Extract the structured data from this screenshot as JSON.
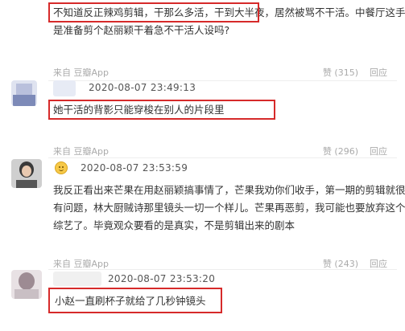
{
  "comments": [
    {
      "lines": [
        "不知道反正辣鸡剪辑，干那么多活，干到大半夜，居然被骂不干活。中餐厅这手",
        "是准备剪个赵丽颖干着急不干活人设吗?"
      ],
      "source": "来自 豆瓣App",
      "like_label": "赞 (315)",
      "reply_label": "回应"
    },
    {
      "time": "2020-08-07 23:49:13",
      "lines": [
        "她干活的背影只能穿梭在别人的片段里"
      ],
      "source": "来自 豆瓣App",
      "like_label": "赞 (296)",
      "reply_label": "回应"
    },
    {
      "time": "2020-08-07 23:53:59",
      "lines": [
        "我反正看出来芒果在用赵丽颖搞事情了，芒果我劝你们收手，第一期的剪辑就很",
        "有问题，林大厨贼诗那里镜头一切一个样儿。芒果再恶剪，我可能也要放弃这个",
        "综艺了。毕竟观众要看的是真实，不是剪辑出来的剧本"
      ],
      "source": "来自 豆瓣App",
      "like_label": "赞 (243)",
      "reply_label": "回应"
    },
    {
      "time": "2020-08-07 23:53:20",
      "lines": [
        "小赵一直刷杯子就给了几秒钟镜头"
      ]
    }
  ]
}
